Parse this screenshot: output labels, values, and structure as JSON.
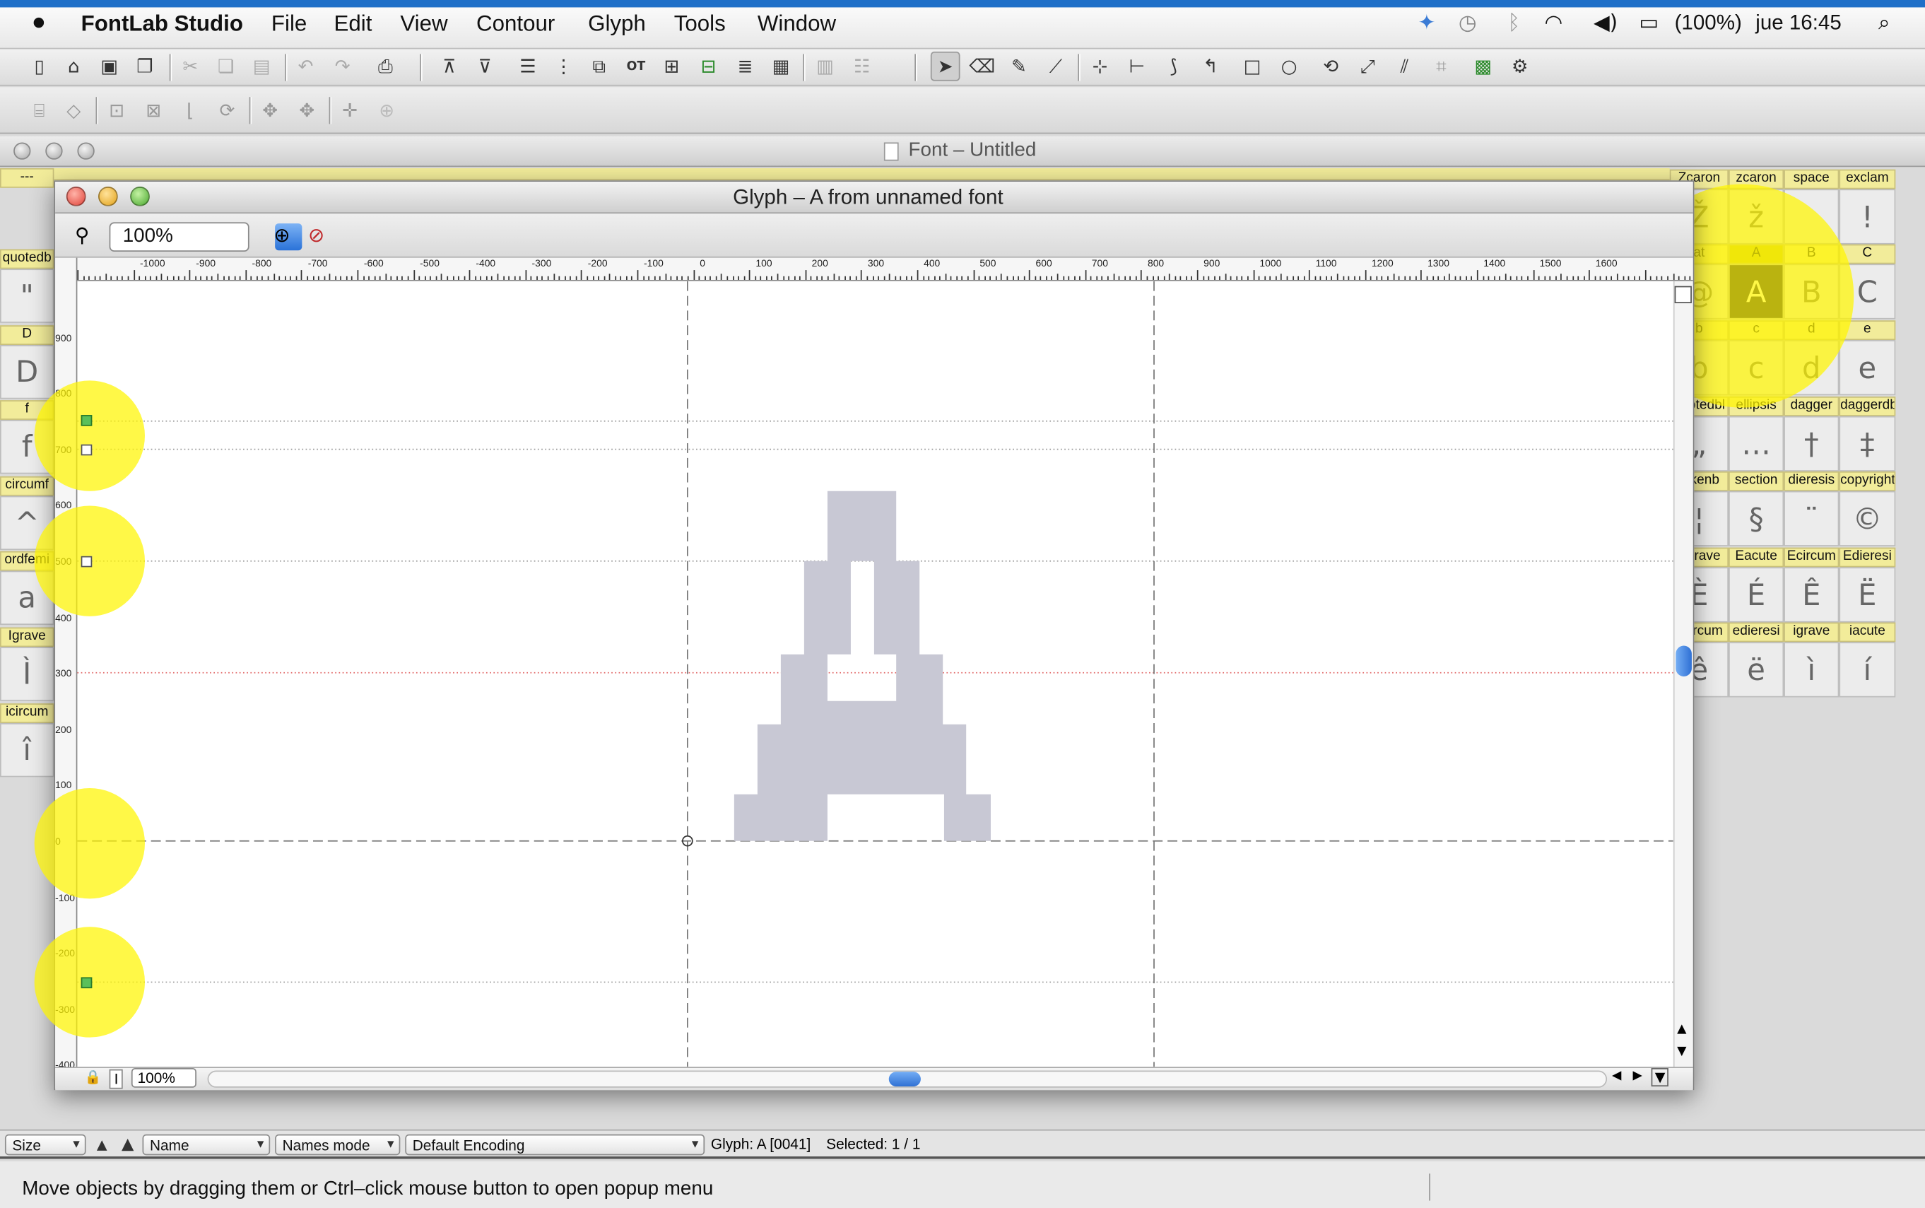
{
  "menubar": {
    "apple": "",
    "app_name": "FontLab Studio",
    "items": [
      "File",
      "Edit",
      "View",
      "Contour",
      "Glyph",
      "Tools",
      "Window"
    ],
    "battery": "(100%)",
    "clock": "jue 16:45"
  },
  "font_window": {
    "title": "Font – Untitled"
  },
  "glyph_window": {
    "title": "Glyph – A from unnamed font",
    "zoom": "100%",
    "bottom_zoom": "100%"
  },
  "left_cells": [
    {
      "name": "---",
      "glyph": ""
    },
    {
      "name": "quotedb",
      "glyph": "\""
    },
    {
      "name": "D",
      "glyph": "D"
    },
    {
      "name": "f",
      "glyph": "f"
    },
    {
      "name": "circumf",
      "glyph": "^"
    },
    {
      "name": "ordfemi",
      "glyph": "a"
    },
    {
      "name": "Igrave",
      "glyph": "Ì"
    },
    {
      "name": "icircum",
      "glyph": "î"
    }
  ],
  "right_cells": {
    "rows": [
      {
        "names": [
          "Zcaron",
          "zcaron",
          "space",
          "exclam"
        ],
        "glyphs": [
          "Ž",
          "ž",
          "",
          "!"
        ]
      },
      {
        "names": [
          "at",
          "A",
          "B",
          "C"
        ],
        "glyphs": [
          "@",
          "A",
          "B",
          "C"
        ]
      },
      {
        "names": [
          "b",
          "c",
          "d",
          "e"
        ],
        "glyphs": [
          "b",
          "c",
          "d",
          "e"
        ]
      },
      {
        "names": [
          "quotedbl",
          "ellipsis",
          "dagger",
          "daggerdbl"
        ],
        "glyphs": [
          "„",
          "…",
          "†",
          "‡"
        ]
      },
      {
        "names": [
          "tokenb",
          "section",
          "dieresis",
          "copyright"
        ],
        "glyphs": [
          "¦",
          "§",
          "¨",
          "©"
        ]
      },
      {
        "names": [
          "Egrave",
          "Eacute",
          "Ecircum",
          "Edieresi"
        ],
        "glyphs": [
          "È",
          "É",
          "Ê",
          "Ë"
        ]
      },
      {
        "names": [
          "ecircum",
          "edieresi",
          "igrave",
          "iacute"
        ],
        "glyphs": [
          "ê",
          "ë",
          "ì",
          "í"
        ]
      }
    ]
  },
  "ruler": {
    "h_labels": [
      "-1000",
      "-900",
      "-800",
      "-700",
      "-600",
      "-500",
      "-400",
      "-300",
      "-200",
      "-100",
      "0",
      "100",
      "200",
      "300",
      "400",
      "500",
      "600",
      "700",
      "800",
      "900",
      "1000",
      "1100",
      "1200",
      "1300",
      "1400",
      "1500",
      "1600"
    ],
    "v_labels": [
      "900",
      "800",
      "700",
      "600",
      "500",
      "400",
      "300",
      "200",
      "100",
      "0",
      "-100",
      "-200",
      "-300",
      "-400"
    ]
  },
  "statusbar": {
    "size": "Size",
    "name": "Name",
    "names_mode": "Names mode",
    "encoding": "Default Encoding",
    "glyph_info": "Glyph: A [0041]",
    "selected": "Selected: 1 / 1"
  },
  "hint": "Move objects by dragging them or Ctrl–click mouse button to open popup menu",
  "colors": {
    "glyph_fill": "#c8c8d4",
    "highlight": "#fff500",
    "selected_cell": "#0a0a3a",
    "header_yellow": "#f2ec9a"
  }
}
